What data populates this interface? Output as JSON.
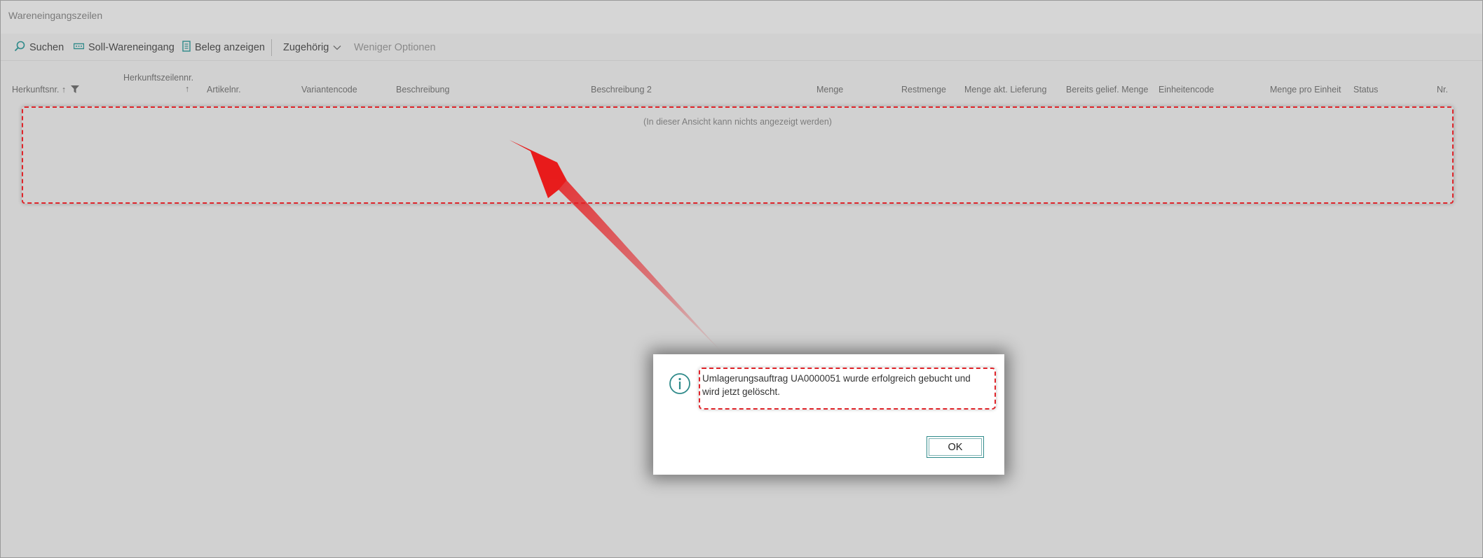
{
  "window": {
    "title": "Wareneingangszeilen"
  },
  "toolbar": {
    "search_label": "Suchen",
    "search_icon": "search-icon",
    "soll_label": "Soll-Wareneingang",
    "soll_icon": "receipt-icon",
    "beleg_label": "Beleg anzeigen",
    "beleg_icon": "document-icon",
    "related_label": "Zugehörig",
    "related_icon": "chevron-down-icon",
    "less_options_label": "Weniger Optionen"
  },
  "table": {
    "columns": [
      "Herkunftsnr. ↑",
      "Herkunftszeilennr.",
      "Artikelnr.",
      "Variantencode",
      "Beschreibung",
      "Beschreibung 2",
      "Menge",
      "Restmenge",
      "Menge akt. Lieferung",
      "Bereits gelief. Menge",
      "Einheitencode",
      "Menge pro Einheit",
      "Status",
      "Nr."
    ],
    "sort_arrow": "↑",
    "empty_message": "(In dieser Ansicht kann nichts angezeigt werden)"
  },
  "dialog": {
    "message": "Umlagerungsauftrag UA0000051 wurde erfolgreich gebucht und wird jetzt gelöscht.",
    "ok_label": "OK",
    "icon": "info-icon"
  },
  "colors": {
    "background": "#d1d1d1",
    "highlight_red": "#e0242a",
    "accent_teal": "#2f8a8a"
  }
}
